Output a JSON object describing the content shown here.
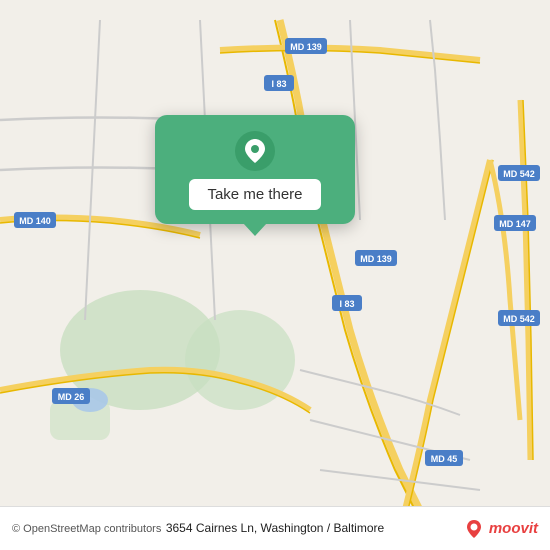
{
  "map": {
    "background_color": "#f2efe9",
    "center_lat": 39.35,
    "center_lng": -76.65
  },
  "card": {
    "button_label": "Take me there",
    "bg_color": "#4caf7d"
  },
  "bottom_bar": {
    "copyright": "© OpenStreetMap contributors",
    "address": "3654 Cairnes Ln, Washington / Baltimore",
    "brand": "moovit"
  }
}
